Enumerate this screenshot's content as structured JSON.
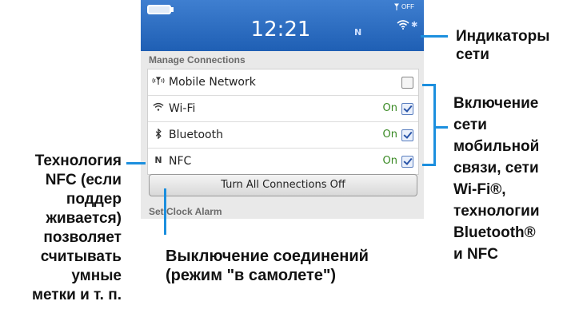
{
  "status_bar": {
    "time": "12:21",
    "signal_text": "OFF",
    "nfc_indicator": "N",
    "icons": [
      "battery-icon",
      "antenna-icon",
      "wifi-icon",
      "bluetooth-icon"
    ]
  },
  "manage_connections": {
    "header": "Manage Connections",
    "items": [
      {
        "icon": "antenna-icon",
        "label": "Mobile Network",
        "state": "",
        "checked": false
      },
      {
        "icon": "wifi-icon",
        "label": "Wi-Fi",
        "state": "On",
        "checked": true
      },
      {
        "icon": "bluetooth-icon",
        "label": "Bluetooth",
        "state": "On",
        "checked": true
      },
      {
        "icon": "nfc-icon",
        "label": "NFC",
        "state": "On",
        "checked": true
      }
    ],
    "turn_off_button": "Turn All Connections Off"
  },
  "set_clock_alarm": {
    "header": "Set Clock Alarm"
  },
  "annotations": {
    "network_indicators": [
      "Индикаторы",
      "сети"
    ],
    "enable_connections": [
      "Включение",
      "сети",
      "мобильной",
      "связи, сети",
      "Wi-Fi®,",
      "технологии",
      "Bluetooth®",
      "и NFC"
    ],
    "nfc_description": [
      "Технология",
      "NFC (если",
      "поддер",
      "живается)",
      "позволяет",
      "считывать",
      "умные",
      "метки и т. п."
    ],
    "airplane_mode": [
      "Выключение соединений",
      "(режим \"в самолете\")"
    ]
  },
  "colors": {
    "status_bar": "#2a69bf",
    "on_state": "#3a8a25",
    "callout_line": "#1c8fde"
  }
}
